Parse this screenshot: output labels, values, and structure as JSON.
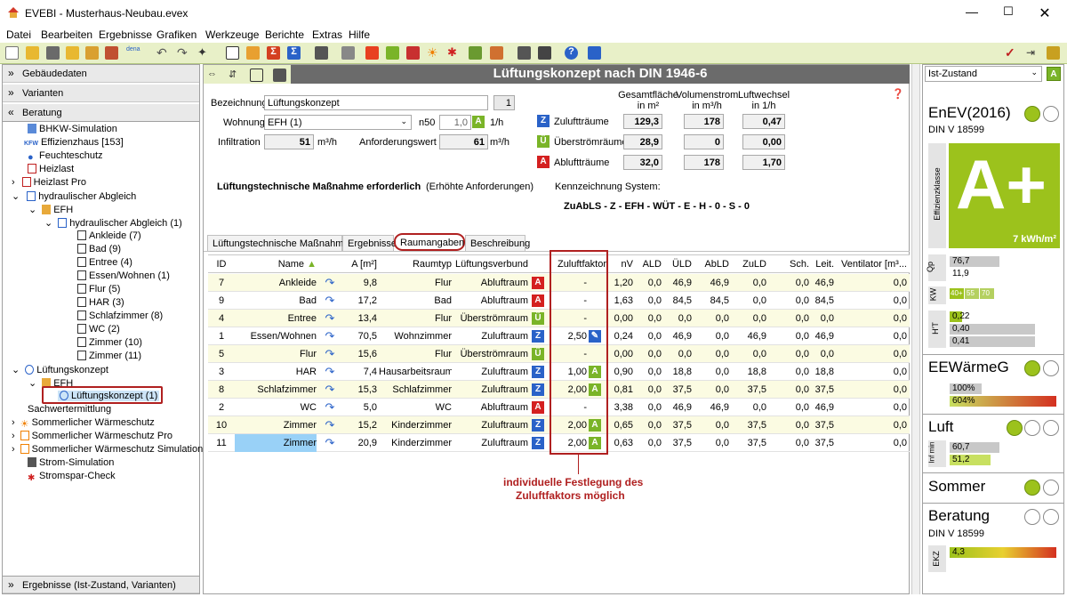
{
  "window": {
    "title": "EVEBI - Musterhaus-Neubau.evex"
  },
  "menu": [
    "Datei",
    "Bearbeiten",
    "Ergebnisse",
    "Grafiken",
    "Werkzeuge",
    "Berichte",
    "Extras",
    "Hilfe"
  ],
  "left": {
    "sections": {
      "gebaeudedaten": "Gebäudedaten",
      "varianten": "Varianten",
      "beratung": "Beratung",
      "ergebnisse": "Ergebnisse (Ist-Zustand, Varianten)"
    },
    "tree": [
      "BHKW-Simulation",
      "Effizienzhaus [153]",
      "Feuchteschutz",
      "Heizlast",
      "Heizlast Pro",
      "hydraulischer Abgleich",
      "EFH",
      "hydraulischer Abgleich (1)",
      "Ankleide (7)",
      "Bad (9)",
      "Entree (4)",
      "Essen/Wohnen (1)",
      "Flur (5)",
      "HAR (3)",
      "Schlafzimmer (8)",
      "WC (2)",
      "Zimmer (10)",
      "Zimmer (11)",
      "Lüftungskonzept",
      "EFH",
      "Lüftungskonzept (1)",
      "Sachwertermittlung",
      "Sommerlicher Wärmeschutz",
      "Sommerlicher Wärmeschutz Pro",
      "Sommerlicher Wärmeschutz Simulation",
      "Strom-Simulation",
      "Stromspar-Check"
    ],
    "kfw_label": "KFW"
  },
  "main": {
    "header": "Lüftungskonzept nach DIN 1946-6",
    "bezeichnung_label": "Bezeichnung",
    "bezeichnung_value": "Lüftungskonzept",
    "bezeichnung_num": "1",
    "wohnung_label": "Wohnung",
    "wohnung_value": "EFH (1)",
    "n50_label": "n50",
    "n50_value": "1,0",
    "n50_unit": "1/h",
    "infiltration_label": "Infiltration",
    "infiltration_value": "51",
    "infiltration_unit": "m³/h",
    "anforderung_label": "Anforderungswert",
    "anforderung_value": "61",
    "anforderung_unit": "m³/h",
    "col_headers": {
      "flaeche": "Gesamtfläche",
      "flaeche_unit": "in m²",
      "volumen": "Volumenstrom",
      "volumen_unit": "in m³/h",
      "wechsel": "Luftwechsel",
      "wechsel_unit": "in 1/h"
    },
    "summary": [
      {
        "badge": "Z",
        "label": "Zuluftträume",
        "flaeche": "129,3",
        "volumen": "178",
        "wechsel": "0,47"
      },
      {
        "badge": "Ü",
        "label": "Überströmräume",
        "flaeche": "28,9",
        "volumen": "0",
        "wechsel": "0,00"
      },
      {
        "badge": "A",
        "label": "Abluftträume",
        "flaeche": "32,0",
        "volumen": "178",
        "wechsel": "1,70"
      }
    ],
    "massnahme_bold": "Lüftungstechnische Maßnahme erforderlich",
    "massnahme_rest": "(Erhöhte Anforderungen)",
    "kennzeichnung_label": "Kennzeichnung System:",
    "kennzeichnung_value": "ZuAbLS - Z - EFH - WÜT - E - H - 0 - S - 0",
    "tabs": [
      "Lüftungstechnische Maßnahmen",
      "Ergebnisse",
      "Raumangaben",
      "Beschreibung"
    ],
    "grid_headers": [
      "ID",
      "Name",
      "A [m²]",
      "Raumtyp",
      "Lüftungsverbund",
      "Zuluftfaktor",
      "nV",
      "ALD",
      "ÜLD",
      "AbLD",
      "ZuLD",
      "Sch.",
      "Leit.",
      "Ventilator [m³..."
    ],
    "rows": [
      {
        "id": "7",
        "name": "Ankleide",
        "a": "9,8",
        "raumtyp": "Flur",
        "verbund": "Abluftraum",
        "badge": "A",
        "zf": "-",
        "nv": "1,20",
        "ald": "0,0",
        "uld": "46,9",
        "abld": "46,9",
        "zuld": "0,0",
        "sch": "0,0",
        "leit": "46,9",
        "vent": "0,0"
      },
      {
        "id": "9",
        "name": "Bad",
        "a": "17,2",
        "raumtyp": "Bad",
        "verbund": "Abluftraum",
        "badge": "A",
        "zf": "-",
        "nv": "1,63",
        "ald": "0,0",
        "uld": "84,5",
        "abld": "84,5",
        "zuld": "0,0",
        "sch": "0,0",
        "leit": "84,5",
        "vent": "0,0"
      },
      {
        "id": "4",
        "name": "Entree",
        "a": "13,4",
        "raumtyp": "Flur",
        "verbund": "Überströmraum",
        "badge": "Ü",
        "zf": "-",
        "nv": "0,00",
        "ald": "0,0",
        "uld": "0,0",
        "abld": "0,0",
        "zuld": "0,0",
        "sch": "0,0",
        "leit": "0,0",
        "vent": "0,0"
      },
      {
        "id": "1",
        "name": "Essen/Wohnen",
        "a": "70,5",
        "raumtyp": "Wohnzimmer",
        "verbund": "Zuluftraum",
        "badge": "Z",
        "zf": "2,50",
        "zfb": "edit",
        "nv": "0,24",
        "ald": "0,0",
        "uld": "46,9",
        "abld": "0,0",
        "zuld": "46,9",
        "sch": "0,0",
        "leit": "46,9",
        "vent": "0,0"
      },
      {
        "id": "5",
        "name": "Flur",
        "a": "15,6",
        "raumtyp": "Flur",
        "verbund": "Überströmraum",
        "badge": "Ü",
        "zf": "-",
        "nv": "0,00",
        "ald": "0,0",
        "uld": "0,0",
        "abld": "0,0",
        "zuld": "0,0",
        "sch": "0,0",
        "leit": "0,0",
        "vent": "0,0"
      },
      {
        "id": "3",
        "name": "HAR",
        "a": "7,4",
        "raumtyp": "Hausarbeitsraum",
        "verbund": "Zuluftraum",
        "badge": "Z",
        "zf": "1,00",
        "zfb": "A",
        "nv": "0,90",
        "ald": "0,0",
        "uld": "18,8",
        "abld": "0,0",
        "zuld": "18,8",
        "sch": "0,0",
        "leit": "18,8",
        "vent": "0,0"
      },
      {
        "id": "8",
        "name": "Schlafzimmer",
        "a": "15,3",
        "raumtyp": "Schlafzimmer",
        "verbund": "Zuluftraum",
        "badge": "Z",
        "zf": "2,00",
        "zfb": "A",
        "nv": "0,81",
        "ald": "0,0",
        "uld": "37,5",
        "abld": "0,0",
        "zuld": "37,5",
        "sch": "0,0",
        "leit": "37,5",
        "vent": "0,0"
      },
      {
        "id": "2",
        "name": "WC",
        "a": "5,0",
        "raumtyp": "WC",
        "verbund": "Abluftraum",
        "badge": "A",
        "zf": "-",
        "nv": "3,38",
        "ald": "0,0",
        "uld": "46,9",
        "abld": "46,9",
        "zuld": "0,0",
        "sch": "0,0",
        "leit": "46,9",
        "vent": "0,0"
      },
      {
        "id": "10",
        "name": "Zimmer",
        "a": "15,2",
        "raumtyp": "Kinderzimmer",
        "verbund": "Zuluftraum",
        "badge": "Z",
        "zf": "2,00",
        "zfb": "A",
        "nv": "0,65",
        "ald": "0,0",
        "uld": "37,5",
        "abld": "0,0",
        "zuld": "37,5",
        "sch": "0,0",
        "leit": "37,5",
        "vent": "0,0"
      },
      {
        "id": "11",
        "name": "Zimmer",
        "a": "20,9",
        "raumtyp": "Kinderzimmer",
        "verbund": "Zuluftraum",
        "badge": "Z",
        "zf": "2,00",
        "zfb": "A",
        "nv": "0,63",
        "ald": "0,0",
        "uld": "37,5",
        "abld": "0,0",
        "zuld": "37,5",
        "sch": "0,0",
        "leit": "37,5",
        "vent": "0,0"
      }
    ],
    "annotation_line1": "individuelle Festlegung des",
    "annotation_line2": "Zuluftfaktors möglich"
  },
  "right": {
    "select": "Ist-Zustand",
    "select_badge": "A",
    "enev_title": "EnEV(2016)",
    "enev_sub": "DIN V 18599",
    "eff_label": "Effizienzklasse",
    "eff_class": "A+",
    "eff_value": "7 kWh/m²",
    "qp_label": "Qp",
    "qp_values": [
      "76,7",
      "11,9"
    ],
    "kw_label": "KW",
    "kw_values": [
      "40+",
      "55",
      "70"
    ],
    "ht_label": "H'T",
    "ht_values": [
      "0,22",
      "0,40",
      "0,41"
    ],
    "eew_title": "EEWärmeG",
    "eew_values": [
      "100%",
      "604%"
    ],
    "luft_title": "Luft",
    "luft_label": "Inf min",
    "luft_values": [
      "60,7",
      "51,2"
    ],
    "sommer_title": "Sommer",
    "beratung_title": "Beratung",
    "beratung_sub": "DIN V 18599",
    "ekz_label": "EKZ",
    "ekz_value": "4,3"
  }
}
